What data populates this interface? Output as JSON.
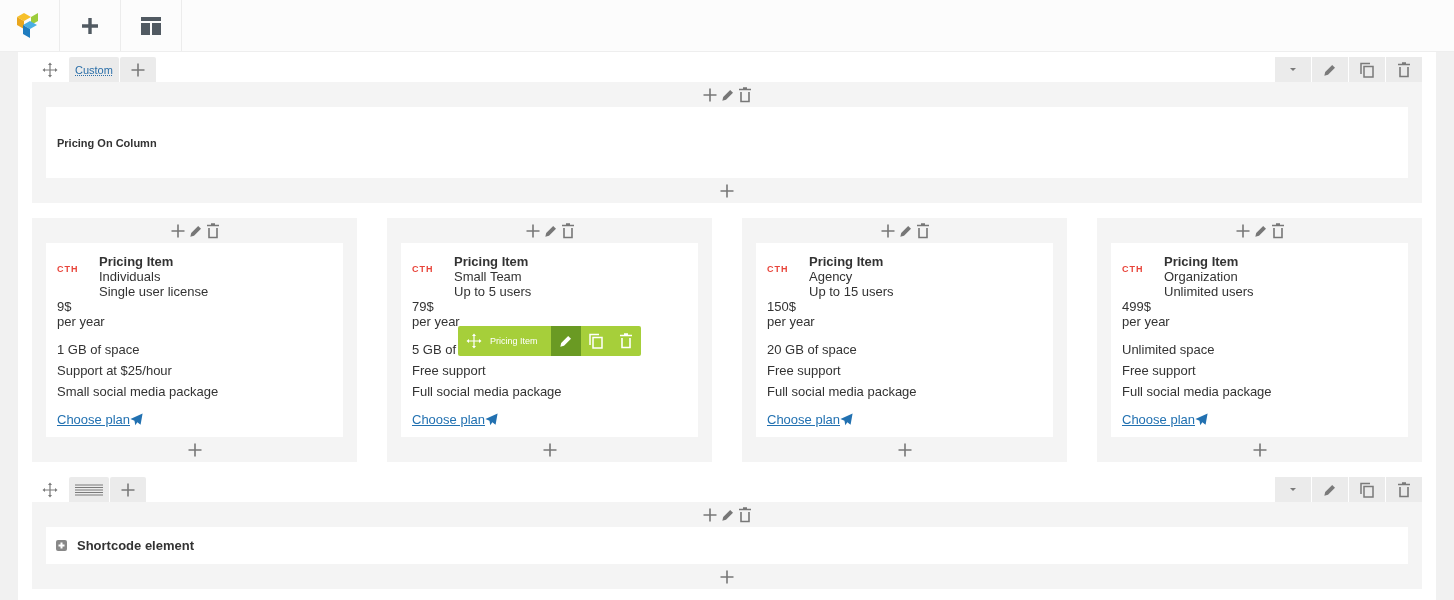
{
  "text_row": {
    "layout_label": "Custom",
    "element_title": "Pricing On Column"
  },
  "pricing_columns": [
    {
      "logo_text": "CTH",
      "title": "Pricing Item",
      "name": "Individuals",
      "subtitle": "Single user license",
      "price": "9$",
      "period": "per year",
      "features": [
        "1 GB of space",
        "Support at $25/hour",
        "Small social media package"
      ],
      "link": "Choose plan",
      "hovered": false
    },
    {
      "logo_text": "CTH",
      "title": "Pricing Item",
      "name": "Small Team",
      "subtitle": "Up to 5 users",
      "price": "79$",
      "period": "per year",
      "features": [
        "5 GB of",
        "Free support",
        "Full social media package"
      ],
      "link": "Choose plan",
      "hovered": true
    },
    {
      "logo_text": "CTH",
      "title": "Pricing Item",
      "name": "Agency",
      "subtitle": "Up to 15 users",
      "price": "150$",
      "period": "per year",
      "features": [
        "20 GB of space",
        "Free support",
        "Full social media package"
      ],
      "link": "Choose plan",
      "hovered": false
    },
    {
      "logo_text": "CTH",
      "title": "Pricing Item",
      "name": "Organization",
      "subtitle": "Unlimited users",
      "price": "499$",
      "period": "per year",
      "features": [
        "Unlimited space",
        "Free support",
        "Full social media package"
      ],
      "link": "Choose plan",
      "hovered": false
    }
  ],
  "hover_toolbar": {
    "label": "Pricing Item"
  },
  "shortcode_row": {
    "element_title": "Shortcode element"
  }
}
